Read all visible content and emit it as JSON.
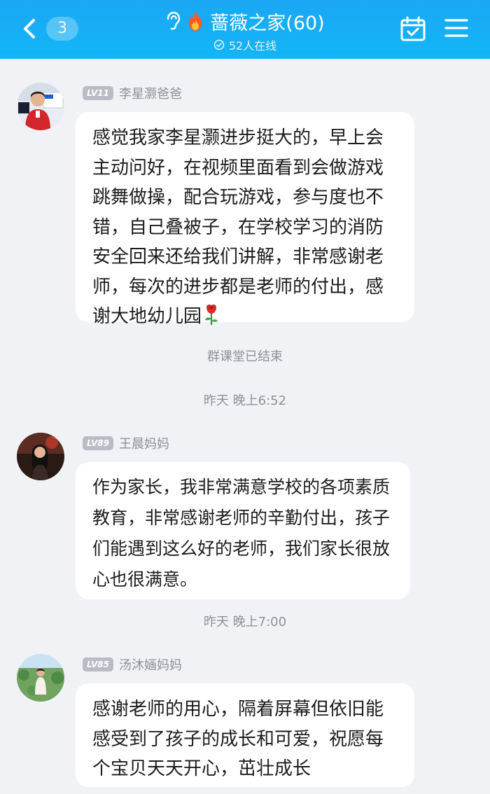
{
  "header": {
    "back_count": "3",
    "title": "蔷薇之家(60)",
    "online": "52人在线"
  },
  "messages": [
    {
      "level": "LV11",
      "sender": "李星灏爸爸",
      "text": "感觉我家李星灏进步挺大的，早上会主动问好，在视频里面看到会做游戏跳舞做操，配合玩游戏，参与度也不错，自己叠被子，在学校学习的消防安全回来还给我们讲解，非常感谢老师，每次的进步都是老师的付出，感谢大地幼儿园"
    },
    {
      "level": "LV89",
      "sender": "王晨妈妈",
      "text": "作为家长，我非常满意学校的各项素质教育，非常感谢老师的辛勤付出，孩子们能遇到这么好的老师，我们家长很放心也很满意。"
    },
    {
      "level": "LV85",
      "sender": "汤沐婳妈妈",
      "text": "感谢老师的用心，隔着屏幕但依旧能感受到了孩子的成长和可爱，祝愿每个宝贝天天开心，茁壮成长"
    }
  ],
  "system": {
    "class_ended": "群课堂已结束",
    "time_1": "昨天 晚上6:52",
    "time_2": "昨天 晚上7:00"
  },
  "icons": {
    "back": "chevron-left-icon",
    "hearing": "ear-icon",
    "fire": "flame-icon",
    "online": "check-circle-icon",
    "calendar": "calendar-check-icon",
    "menu": "hamburger-menu-icon",
    "rose": "rose-emoji-icon"
  },
  "colors": {
    "header": "#1ba7f4",
    "background": "#f1f2f5",
    "bubble": "#ffffff",
    "level_badge": "#b9bcc6"
  }
}
